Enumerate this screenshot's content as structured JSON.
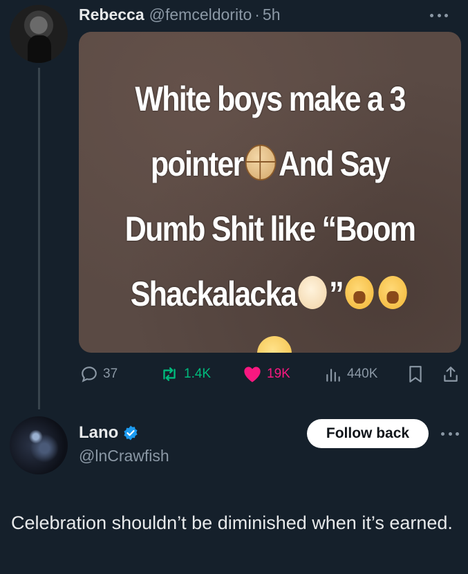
{
  "tweet": {
    "display_name": "Rebecca",
    "handle": "@femceldorito",
    "separator": "·",
    "time": "5h",
    "media_lines": [
      "White boys make a 3",
      "pointer",
      "And Say",
      "Dumb Shit like “Boom",
      "Shackalacka",
      "”"
    ],
    "stats": {
      "replies": "37",
      "reposts": "1.4K",
      "likes": "19K",
      "views": "440K"
    },
    "icons": [
      "reply-icon",
      "repost-icon",
      "heart-icon",
      "views-icon",
      "bookmark-icon",
      "share-icon",
      "more-icon"
    ],
    "like_color": "#f91880",
    "repost_color": "#00ba7c"
  },
  "reply": {
    "display_name": "Lano",
    "handle": "@lnCrawfish",
    "follow_label": "Follow back",
    "text": "Celebration shouldn’t be diminished when it’s earned.",
    "verified_color": "#1d9bf0"
  },
  "theme": {
    "background": "#15202b",
    "secondary_text": "#8b98a5"
  }
}
